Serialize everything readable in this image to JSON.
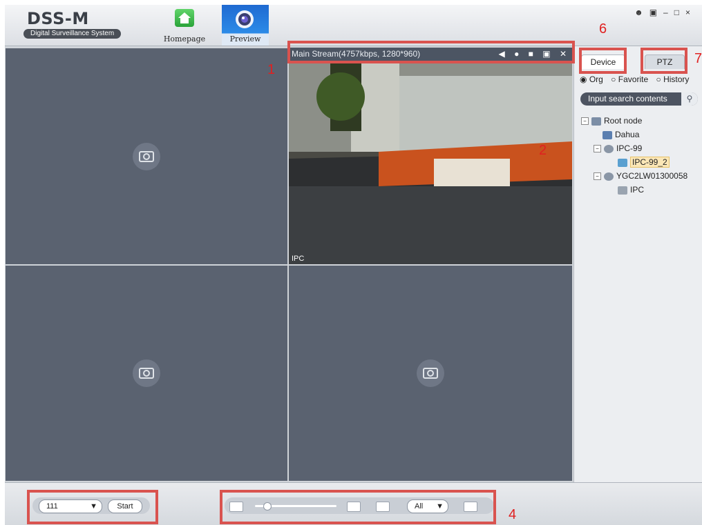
{
  "header": {
    "logo_title": "DSS-M",
    "logo_subtitle": "Digital Surveillance System",
    "nav": [
      {
        "label": "Homepage",
        "icon": "home-icon"
      },
      {
        "label": "Preview",
        "icon": "camera-lens-icon",
        "active": true
      }
    ],
    "window_controls": [
      "user-icon",
      "lock-icon",
      "minimize-icon",
      "maximize-icon",
      "close-icon"
    ]
  },
  "video": {
    "stream_info": "Main Stream(4757kbps, 1280*960)",
    "stream_icons": [
      "speaker-icon",
      "microphone-icon",
      "record-icon",
      "snapshot-icon",
      "close-icon"
    ],
    "channel_label": "IPC"
  },
  "side": {
    "tabs": [
      {
        "label": "Device",
        "active": true
      },
      {
        "label": "PTZ"
      }
    ],
    "radios": [
      {
        "label": "Org",
        "checked": true
      },
      {
        "label": "Favorite"
      },
      {
        "label": "History"
      }
    ],
    "search_placeholder": "Input search contents",
    "tree": [
      {
        "label": "Root node",
        "toggle": "⊟",
        "level": 0,
        "icon": "org-icon"
      },
      {
        "label": "Dahua",
        "level": 1,
        "icon": "network-icon"
      },
      {
        "label": "IPC-99",
        "toggle": "⊟",
        "level": 1,
        "icon": "device-icon"
      },
      {
        "label": "IPC-99_2",
        "level": 2,
        "icon": "camera-icon",
        "selected": true
      },
      {
        "label": "YGC2LW01300058",
        "toggle": "⊟",
        "level": 1,
        "icon": "device-icon"
      },
      {
        "label": "IPC",
        "level": 2,
        "icon": "camera-icon"
      }
    ]
  },
  "bottom": {
    "view_select": "111",
    "start_label": "Start",
    "stream_select": "All",
    "tools": [
      "layout-icon",
      "zoom-slider",
      "grid-icon",
      "custom-layout-icon",
      "fullscreen-icon"
    ]
  },
  "annotations": [
    "1",
    "2",
    "4",
    "6",
    "7"
  ],
  "colors": {
    "annotation": "#d9534f",
    "cell_bg": "#5a6270",
    "accent_blue": "#1f6ad1"
  }
}
